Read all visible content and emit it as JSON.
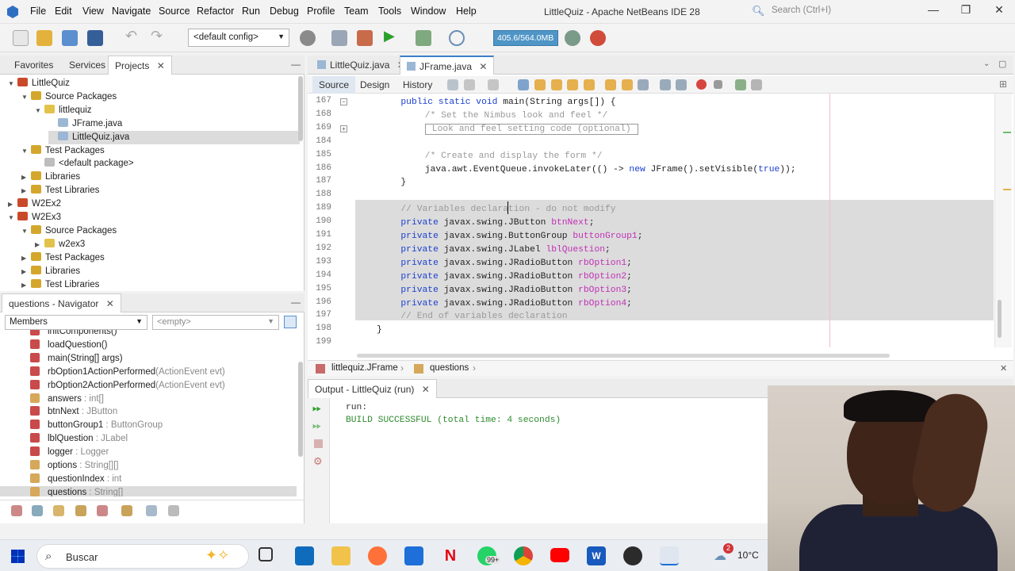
{
  "menu": [
    "File",
    "Edit",
    "View",
    "Navigate",
    "Source",
    "Refactor",
    "Run",
    "Debug",
    "Profile",
    "Team",
    "Tools",
    "Window",
    "Help"
  ],
  "window_title": "LittleQuiz - Apache NetBeans IDE 28",
  "search_placeholder": "Search (Ctrl+I)",
  "config_select": "<default config>",
  "memory": "405.6/564.0MB",
  "left_tabs": [
    "Favorites",
    "Services",
    "Projects"
  ],
  "project_tree": [
    {
      "label": "LittleQuiz",
      "indent": 0,
      "caret": "▼",
      "icon": "#c94a2b"
    },
    {
      "label": "Source Packages",
      "indent": 1,
      "caret": "▼",
      "icon": "#d4a72c"
    },
    {
      "label": "littlequiz",
      "indent": 2,
      "caret": "▼",
      "icon": "#e3c24a"
    },
    {
      "label": "JFrame.java",
      "indent": 3,
      "caret": "",
      "icon": "#9bb7d4"
    },
    {
      "label": "LittleQuiz.java",
      "indent": 3,
      "caret": "",
      "icon": "#9bb7d4"
    },
    {
      "label": "Test Packages",
      "indent": 1,
      "caret": "▼",
      "icon": "#d4a72c"
    },
    {
      "label": "<default package>",
      "indent": 2,
      "caret": "",
      "icon": "#bdbdbd"
    },
    {
      "label": "Libraries",
      "indent": 1,
      "caret": "▶",
      "icon": "#d4a72c"
    },
    {
      "label": "Test Libraries",
      "indent": 1,
      "caret": "▶",
      "icon": "#d4a72c"
    },
    {
      "label": "W2Ex2",
      "indent": 0,
      "caret": "▶",
      "icon": "#c94a2b"
    },
    {
      "label": "W2Ex3",
      "indent": 0,
      "caret": "▼",
      "icon": "#c94a2b"
    },
    {
      "label": "Source Packages",
      "indent": 1,
      "caret": "▼",
      "icon": "#d4a72c"
    },
    {
      "label": "w2ex3",
      "indent": 2,
      "caret": "▶",
      "icon": "#e3c24a"
    },
    {
      "label": "Test Packages",
      "indent": 1,
      "caret": "▶",
      "icon": "#d4a72c"
    },
    {
      "label": "Libraries",
      "indent": 1,
      "caret": "▶",
      "icon": "#d4a72c"
    },
    {
      "label": "Test Libraries",
      "indent": 1,
      "caret": "▶",
      "icon": "#d4a72c"
    }
  ],
  "navigator": {
    "title": "questions - Navigator",
    "members_label": "Members",
    "filter_label": "<empty>",
    "items": [
      {
        "name": "initComponents()",
        "type": "",
        "icon": "#c94a4a"
      },
      {
        "name": "loadQuestion()",
        "type": "",
        "icon": "#c94a4a"
      },
      {
        "name": "main(String[] args)",
        "type": "",
        "icon": "#c94a4a"
      },
      {
        "name": "rbOption1ActionPerformed",
        "type": "(ActionEvent evt)",
        "icon": "#c94a4a"
      },
      {
        "name": "rbOption2ActionPerformed",
        "type": "(ActionEvent evt)",
        "icon": "#c94a4a"
      },
      {
        "name": "answers",
        "type": " : int[]",
        "icon": "#d6a85a"
      },
      {
        "name": "btnNext",
        "type": " : JButton",
        "icon": "#c94a4a"
      },
      {
        "name": "buttonGroup1",
        "type": " : ButtonGroup",
        "icon": "#c94a4a"
      },
      {
        "name": "lblQuestion",
        "type": " : JLabel",
        "icon": "#c94a4a"
      },
      {
        "name": "logger",
        "type": " : Logger",
        "icon": "#c94a4a"
      },
      {
        "name": "options",
        "type": " : String[][]",
        "icon": "#d6a85a"
      },
      {
        "name": "questionIndex",
        "type": " : int",
        "icon": "#d6a85a"
      },
      {
        "name": "questions",
        "type": " : String[]",
        "icon": "#d6a85a"
      }
    ]
  },
  "editor_tabs": [
    "LittleQuiz.java",
    "JFrame.java"
  ],
  "editor_subtabs": [
    "Source",
    "Design",
    "History"
  ],
  "code": [
    {
      "ln": "167",
      "indent": 4,
      "parts": [
        [
          "kw",
          "public static void "
        ],
        [
          "",
          "main(String args[]) {"
        ]
      ]
    },
    {
      "ln": "168",
      "indent": 8,
      "parts": [
        [
          "cm",
          "/* Set the Nimbus look and feel */"
        ]
      ]
    },
    {
      "ln": "169",
      "indent": 8,
      "parts": [
        [
          "box",
          "Look and feel setting code (optional)"
        ]
      ]
    },
    {
      "ln": "184",
      "indent": 0,
      "parts": []
    },
    {
      "ln": "185",
      "indent": 8,
      "parts": [
        [
          "cm",
          "/* Create and display the form */"
        ]
      ]
    },
    {
      "ln": "186",
      "indent": 8,
      "parts": [
        [
          "",
          "java.awt.EventQueue.invokeLater(() -> "
        ],
        [
          "kw",
          "new "
        ],
        [
          "",
          "JFrame().setVisible("
        ],
        [
          "kw",
          "true"
        ],
        [
          "",
          "));"
        ]
      ]
    },
    {
      "ln": "187",
      "indent": 4,
      "parts": [
        [
          "",
          "}"
        ]
      ]
    },
    {
      "ln": "188",
      "indent": 0,
      "parts": []
    },
    {
      "ln": "189",
      "indent": 4,
      "parts": [
        [
          "cm",
          "// Variables declaration - do not modify"
        ]
      ]
    },
    {
      "ln": "190",
      "indent": 4,
      "parts": [
        [
          "kw",
          "private "
        ],
        [
          "",
          "javax.swing.JButton "
        ],
        [
          "fld",
          "btnNext"
        ],
        [
          "",
          ";"
        ]
      ]
    },
    {
      "ln": "191",
      "indent": 4,
      "parts": [
        [
          "kw",
          "private "
        ],
        [
          "",
          "javax.swing.ButtonGroup "
        ],
        [
          "fld",
          "buttonGroup1"
        ],
        [
          "",
          ";"
        ]
      ]
    },
    {
      "ln": "192",
      "indent": 4,
      "parts": [
        [
          "kw",
          "private "
        ],
        [
          "",
          "javax.swing.JLabel "
        ],
        [
          "fld",
          "lblQuestion"
        ],
        [
          "",
          ";"
        ]
      ]
    },
    {
      "ln": "193",
      "indent": 4,
      "parts": [
        [
          "kw",
          "private "
        ],
        [
          "",
          "javax.swing.JRadioButton "
        ],
        [
          "fld",
          "rbOption1"
        ],
        [
          "",
          ";"
        ]
      ]
    },
    {
      "ln": "194",
      "indent": 4,
      "parts": [
        [
          "kw",
          "private "
        ],
        [
          "",
          "javax.swing.JRadioButton "
        ],
        [
          "fld",
          "rbOption2"
        ],
        [
          "",
          ";"
        ]
      ]
    },
    {
      "ln": "195",
      "indent": 4,
      "parts": [
        [
          "kw",
          "private "
        ],
        [
          "",
          "javax.swing.JRadioButton "
        ],
        [
          "fld",
          "rbOption3"
        ],
        [
          "",
          ";"
        ]
      ]
    },
    {
      "ln": "196",
      "indent": 4,
      "parts": [
        [
          "kw",
          "private "
        ],
        [
          "",
          "javax.swing.JRadioButton "
        ],
        [
          "fld",
          "rbOption4"
        ],
        [
          "",
          ";"
        ]
      ]
    },
    {
      "ln": "197",
      "indent": 4,
      "parts": [
        [
          "cm",
          "// End of variables declaration"
        ]
      ]
    },
    {
      "ln": "198",
      "indent": 0,
      "parts": [
        [
          "",
          "}"
        ]
      ]
    },
    {
      "ln": "199",
      "indent": 0,
      "parts": []
    }
  ],
  "breadcrumb": [
    "littlequiz.JFrame",
    "questions"
  ],
  "output": {
    "title": "Output - LittleQuiz (run)",
    "lines": [
      "run:",
      "BUILD SUCCESSFUL (total time: 4 seconds)"
    ]
  },
  "taskbar": {
    "search_label": "Buscar",
    "badge_count": "99+",
    "notif_count": "2",
    "weather": "10°C"
  }
}
